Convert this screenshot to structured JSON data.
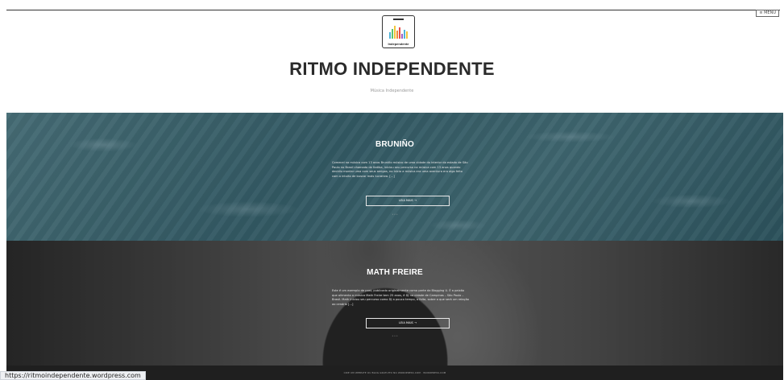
{
  "header": {
    "menu_label": "≡ MENU",
    "logo_text": "Independente",
    "site_title": "RITMO INDEPENDENTE",
    "tagline": "Música Independente"
  },
  "posts": [
    {
      "title": "BRUNIÑO",
      "excerpt": "Comecei na música com 13 anos Bruniño músico de uma cidade do interior do estado de São Paulo no Brasil chamada de Itatiba, iniciou seu percurso na música com 13 anos quando decidiu montar uma com seus amigos, no início a música era uma aventura era algo feito com o intuito de buscar mais lucrativa. […]",
      "read_more": "LEIA MAIS →",
      "separator": "• • •"
    },
    {
      "title": "MATH FREIRE",
      "excerpt": "Este é um exemplo de post, publicado originalmente como parte da Blogging U. É a paixão que alimenta a música Math Freire tem 25 anos, é DJ na cidade de Campinas – São Paulo – Brasil. Math iniciou seu percurso como DJ a pouco tempo, a falta, sobre o que será um relação ao cenário […]",
      "read_more": "LEIA MAIS →",
      "separator": "• • •"
    }
  ],
  "footer": {
    "credit": "CRIE UM WEBSITE OU BLOG GRATUITO NO WORDPRESS.COM · WORDPRESS.COM"
  },
  "status_bar": {
    "url": "https://ritmoindependente.wordpress.com"
  },
  "colors": {
    "title": "#2a2a2a",
    "post_title": "#ffffff",
    "teal_bg": "#3f6c77",
    "footer_bg": "#1f1f1f"
  }
}
